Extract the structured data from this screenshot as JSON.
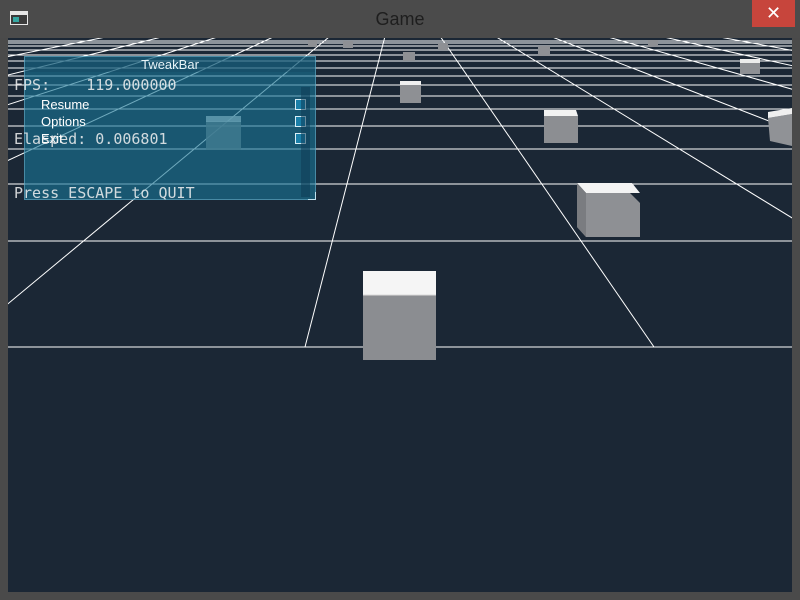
{
  "window": {
    "title": "Game",
    "close_glyph": "✕",
    "icon": "app-window-icon"
  },
  "hud": {
    "lines": [
      "FPS:    119.000000",
      "Elasped: 0.006801",
      "Press ESCAPE to QUIT"
    ]
  },
  "tweakbar": {
    "title": "TweakBar",
    "items": [
      {
        "label": "Resume"
      },
      {
        "label": "Options"
      },
      {
        "label": "Exit"
      }
    ]
  },
  "colors": {
    "sky": "#1b2735",
    "grid": "#ffffff",
    "cube_top": "#f4f4f4",
    "cube_front": "#8a8c90",
    "panel": "#187696",
    "close_button": "#c7453c"
  }
}
